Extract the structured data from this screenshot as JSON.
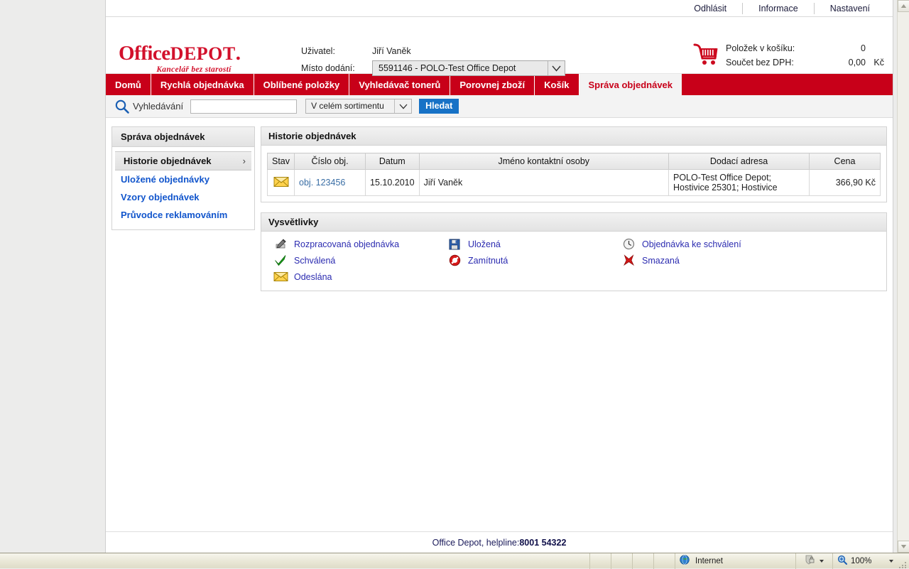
{
  "utility_bar": {
    "links": [
      {
        "label": "Odhlásit",
        "name": "logout-link"
      },
      {
        "label": "Informace",
        "name": "info-link"
      },
      {
        "label": "Nastavení",
        "name": "settings-link"
      }
    ]
  },
  "brand": {
    "logo_office": "Office",
    "logo_depot": "DEPOT",
    "tagline": "Kancelář bez starostí",
    "accent_color": "#d2102b"
  },
  "header": {
    "user_label": "Uživatel:",
    "user_value": "Jiří Vaněk",
    "delivery_label": "Místo dodání:",
    "delivery_selected": "5591146 - POLO-Test Office Depot",
    "cart": {
      "icon": "shopping-cart-icon",
      "items_label": "Položek v košíku:",
      "items_value": "0",
      "subtotal_label": "Součet bez DPH:",
      "subtotal_value": "0,00",
      "currency": "Kč"
    }
  },
  "nav": {
    "active_color": "#c80019",
    "items": [
      {
        "label": "Domů",
        "name": "nav-home",
        "active": false
      },
      {
        "label": "Rychlá objednávka",
        "name": "nav-quick-order",
        "active": false
      },
      {
        "label": "Oblíbené položky",
        "name": "nav-favorites",
        "active": false
      },
      {
        "label": "Vyhledávač tonerů",
        "name": "nav-toner-finder",
        "active": false
      },
      {
        "label": "Porovnej zboží",
        "name": "nav-compare",
        "active": false
      },
      {
        "label": "Košík",
        "name": "nav-cart",
        "active": false
      },
      {
        "label": "Správa objednávek",
        "name": "nav-order-management",
        "active": true
      }
    ]
  },
  "search": {
    "icon": "magnifier-icon",
    "label": "Vyhledávání",
    "input_value": "",
    "input_placeholder": "",
    "scope_selected": "V celém sortimentu",
    "button_label": "Hledat",
    "button_color": "#1772c6"
  },
  "sidebar": {
    "title": "Správa objednávek",
    "items": [
      {
        "label": "Historie objednávek",
        "name": "sidebar-item-order-history",
        "active": true,
        "chevron": "›"
      },
      {
        "label": "Uložené objednávky",
        "name": "sidebar-item-saved-orders",
        "active": false
      },
      {
        "label": "Vzory objednávek",
        "name": "sidebar-item-order-templates",
        "active": false
      },
      {
        "label": "Průvodce reklamováním",
        "name": "sidebar-item-complaint-guide",
        "active": false
      }
    ]
  },
  "orders_panel": {
    "title": "Historie objednávek",
    "columns": [
      "Stav",
      "Číslo obj.",
      "Datum",
      "Jméno kontaktní osoby",
      "Dodací adresa",
      "Cena"
    ],
    "rows": [
      {
        "status_icon": "envelope-icon",
        "status_meaning": "Odeslána",
        "order_number": "obj. 123456",
        "date": "15.10.2010",
        "contact_name": "Jiří Vaněk",
        "address_line1": "POLO-Test Office Depot;",
        "address_line2": "Hostivice 25301; Hostivice",
        "price": "366,90",
        "currency": "Kč"
      }
    ]
  },
  "legend_panel": {
    "title": "Vysvětlivky",
    "columns": [
      [
        {
          "icon": "draft-pen-icon",
          "label": "Rozpracovaná objednávka"
        },
        {
          "icon": "green-check-icon",
          "label": "Schválená"
        },
        {
          "icon": "envelope-icon",
          "label": "Odeslána"
        }
      ],
      [
        {
          "icon": "floppy-disk-icon",
          "label": "Uložená"
        },
        {
          "icon": "red-prohibited-icon",
          "label": "Zamítnutá"
        }
      ],
      [
        {
          "icon": "clock-icon",
          "label": "Objednávka ke schválení"
        },
        {
          "icon": "red-x-icon",
          "label": "Smazaná"
        }
      ]
    ]
  },
  "footer": {
    "text_prefix": "Office Depot, helpline: ",
    "phone": "8001 54322"
  },
  "browser_status_bar": {
    "zone_icon": "globe-icon",
    "zone_label": "Internet",
    "security_icon": "protected-mode-icon",
    "zoom_icon": "zoom-magnifier-icon",
    "zoom_level": "100%"
  }
}
